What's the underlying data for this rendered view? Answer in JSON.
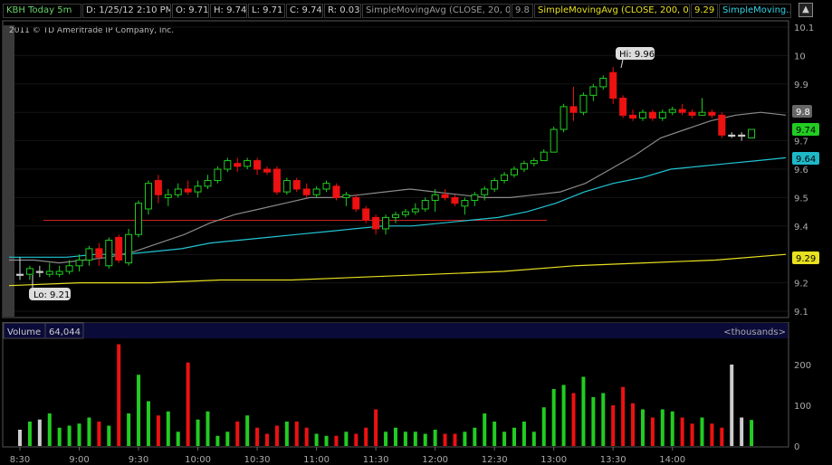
{
  "toolbar": {
    "symbol": "KBH Today 5m",
    "date": "D: 1/25/12 2:10 PM",
    "open": "O: 9.71",
    "high": "H: 9.74",
    "low": "L: 9.71",
    "close": "C: 9.74",
    "range": "R: 0.03",
    "sma20_label": "SimpleMovingAvg (CLOSE, 20, 0)",
    "sma20_value": "9.8",
    "sma200_label": "SimpleMovingAvg (CLOSE, 200, 0)",
    "sma200_value": "9.29",
    "sma_other_label": "SimpleMoving..."
  },
  "copyright": "2011 © TD Ameritrade IP Company, Inc.",
  "colors": {
    "up": "#22cc22",
    "down": "#ee1111",
    "flat": "#cccccc",
    "sma20": "#8a8a8a",
    "sma_cyan": "#22c4d4",
    "sma200": "#e8e020",
    "resistance": "#cc2222",
    "symbol_text": "#6ad36a",
    "date_text": "#cccccc",
    "sma20_text": "#9a9a9a",
    "sma200_text": "#e8e020",
    "sma_cyan_text": "#33d4e4"
  },
  "price_axis": {
    "ticks": [
      "10.1",
      "10",
      "9.9",
      "9.8",
      "9.7",
      "9.6",
      "9.5",
      "9.4",
      "9.3",
      "9.2",
      "9.1"
    ],
    "current_price": "9.74",
    "sma20_value": "9.8",
    "sma_cyan_value": "9.64",
    "sma200_value": "9.29"
  },
  "annotations": {
    "high": "Hi: 9.96",
    "low": "Lo: 9.21"
  },
  "volume": {
    "label": "Volume",
    "value": "64,044",
    "units": "<thousands>",
    "ticks": [
      "200",
      "100",
      "0"
    ]
  },
  "time_axis": [
    "8:30",
    "9:00",
    "9:30",
    "10:00",
    "10:30",
    "11:00",
    "11:30",
    "12:00",
    "12:30",
    "13:00",
    "13:30",
    "14:00"
  ],
  "chart_data": {
    "type": "candlestick",
    "interval": "5m",
    "ylim": [
      9.1,
      10.1
    ],
    "volume_ylim": [
      0,
      260
    ],
    "candles": [
      {
        "o": 9.23,
        "h": 9.29,
        "l": 9.21,
        "c": 9.23,
        "v": 40
      },
      {
        "o": 9.23,
        "h": 9.26,
        "l": 9.21,
        "c": 9.25,
        "v": 60
      },
      {
        "o": 9.24,
        "h": 9.26,
        "l": 9.22,
        "c": 9.24,
        "v": 65
      },
      {
        "o": 9.23,
        "h": 9.27,
        "l": 9.22,
        "c": 9.24,
        "v": 80
      },
      {
        "o": 9.23,
        "h": 9.26,
        "l": 9.22,
        "c": 9.24,
        "v": 45
      },
      {
        "o": 9.24,
        "h": 9.28,
        "l": 9.23,
        "c": 9.26,
        "v": 50
      },
      {
        "o": 9.26,
        "h": 9.3,
        "l": 9.24,
        "c": 9.28,
        "v": 55
      },
      {
        "o": 9.28,
        "h": 9.33,
        "l": 9.26,
        "c": 9.32,
        "v": 70
      },
      {
        "o": 9.32,
        "h": 9.34,
        "l": 9.26,
        "c": 9.29,
        "v": 60
      },
      {
        "o": 9.26,
        "h": 9.36,
        "l": 9.25,
        "c": 9.35,
        "v": 50
      },
      {
        "o": 9.36,
        "h": 9.37,
        "l": 9.27,
        "c": 9.28,
        "v": 250
      },
      {
        "o": 9.27,
        "h": 9.39,
        "l": 9.26,
        "c": 9.37,
        "v": 80
      },
      {
        "o": 9.37,
        "h": 9.49,
        "l": 9.36,
        "c": 9.48,
        "v": 175
      },
      {
        "o": 9.46,
        "h": 9.56,
        "l": 9.44,
        "c": 9.55,
        "v": 110
      },
      {
        "o": 9.56,
        "h": 9.58,
        "l": 9.48,
        "c": 9.51,
        "v": 75
      },
      {
        "o": 9.5,
        "h": 9.53,
        "l": 9.47,
        "c": 9.51,
        "v": 85
      },
      {
        "o": 9.51,
        "h": 9.55,
        "l": 9.5,
        "c": 9.53,
        "v": 35
      },
      {
        "o": 9.53,
        "h": 9.56,
        "l": 9.51,
        "c": 9.52,
        "v": 205
      },
      {
        "o": 9.52,
        "h": 9.56,
        "l": 9.5,
        "c": 9.54,
        "v": 65
      },
      {
        "o": 9.54,
        "h": 9.58,
        "l": 9.53,
        "c": 9.56,
        "v": 85
      },
      {
        "o": 9.56,
        "h": 9.61,
        "l": 9.55,
        "c": 9.6,
        "v": 25
      },
      {
        "o": 9.6,
        "h": 9.64,
        "l": 9.59,
        "c": 9.63,
        "v": 35
      },
      {
        "o": 9.62,
        "h": 9.64,
        "l": 9.59,
        "c": 9.61,
        "v": 60
      },
      {
        "o": 9.61,
        "h": 9.64,
        "l": 9.6,
        "c": 9.63,
        "v": 75
      },
      {
        "o": 9.63,
        "h": 9.64,
        "l": 9.58,
        "c": 9.6,
        "v": 45
      },
      {
        "o": 9.6,
        "h": 9.61,
        "l": 9.58,
        "c": 9.59,
        "v": 30
      },
      {
        "o": 9.6,
        "h": 9.61,
        "l": 9.51,
        "c": 9.52,
        "v": 50
      },
      {
        "o": 9.52,
        "h": 9.57,
        "l": 9.51,
        "c": 9.56,
        "v": 60
      },
      {
        "o": 9.56,
        "h": 9.57,
        "l": 9.52,
        "c": 9.53,
        "v": 60
      },
      {
        "o": 9.53,
        "h": 9.55,
        "l": 9.5,
        "c": 9.51,
        "v": 45
      },
      {
        "o": 9.51,
        "h": 9.54,
        "l": 9.5,
        "c": 9.53,
        "v": 30
      },
      {
        "o": 9.53,
        "h": 9.56,
        "l": 9.52,
        "c": 9.55,
        "v": 25
      },
      {
        "o": 9.54,
        "h": 9.55,
        "l": 9.49,
        "c": 9.5,
        "v": 25
      },
      {
        "o": 9.5,
        "h": 9.52,
        "l": 9.47,
        "c": 9.51,
        "v": 35
      },
      {
        "o": 9.5,
        "h": 9.51,
        "l": 9.45,
        "c": 9.46,
        "v": 30
      },
      {
        "o": 9.46,
        "h": 9.47,
        "l": 9.41,
        "c": 9.42,
        "v": 45
      },
      {
        "o": 9.43,
        "h": 9.44,
        "l": 9.37,
        "c": 9.39,
        "v": 90
      },
      {
        "o": 9.39,
        "h": 9.44,
        "l": 9.37,
        "c": 9.43,
        "v": 35
      },
      {
        "o": 9.43,
        "h": 9.45,
        "l": 9.41,
        "c": 9.44,
        "v": 45
      },
      {
        "o": 9.44,
        "h": 9.46,
        "l": 9.43,
        "c": 9.45,
        "v": 35
      },
      {
        "o": 9.45,
        "h": 9.48,
        "l": 9.44,
        "c": 9.46,
        "v": 35
      },
      {
        "o": 9.46,
        "h": 9.5,
        "l": 9.45,
        "c": 9.49,
        "v": 30
      },
      {
        "o": 9.49,
        "h": 9.53,
        "l": 9.45,
        "c": 9.51,
        "v": 40
      },
      {
        "o": 9.51,
        "h": 9.53,
        "l": 9.49,
        "c": 9.5,
        "v": 30
      },
      {
        "o": 9.5,
        "h": 9.51,
        "l": 9.47,
        "c": 9.48,
        "v": 30
      },
      {
        "o": 9.47,
        "h": 9.5,
        "l": 9.44,
        "c": 9.49,
        "v": 35
      },
      {
        "o": 9.49,
        "h": 9.52,
        "l": 9.47,
        "c": 9.51,
        "v": 45
      },
      {
        "o": 9.51,
        "h": 9.54,
        "l": 9.49,
        "c": 9.53,
        "v": 80
      },
      {
        "o": 9.53,
        "h": 9.57,
        "l": 9.52,
        "c": 9.56,
        "v": 60
      },
      {
        "o": 9.56,
        "h": 9.59,
        "l": 9.55,
        "c": 9.58,
        "v": 35
      },
      {
        "o": 9.58,
        "h": 9.61,
        "l": 9.57,
        "c": 9.6,
        "v": 45
      },
      {
        "o": 9.6,
        "h": 9.63,
        "l": 9.59,
        "c": 9.62,
        "v": 60
      },
      {
        "o": 9.62,
        "h": 9.64,
        "l": 9.61,
        "c": 9.63,
        "v": 35
      },
      {
        "o": 9.63,
        "h": 9.67,
        "l": 9.63,
        "c": 9.66,
        "v": 95
      },
      {
        "o": 9.66,
        "h": 9.75,
        "l": 9.66,
        "c": 9.74,
        "v": 140
      },
      {
        "o": 9.74,
        "h": 9.83,
        "l": 9.73,
        "c": 9.82,
        "v": 150
      },
      {
        "o": 9.82,
        "h": 9.89,
        "l": 9.77,
        "c": 9.8,
        "v": 130
      },
      {
        "o": 9.8,
        "h": 9.87,
        "l": 9.79,
        "c": 9.86,
        "v": 170
      },
      {
        "o": 9.86,
        "h": 9.9,
        "l": 9.84,
        "c": 9.89,
        "v": 120
      },
      {
        "o": 9.89,
        "h": 9.93,
        "l": 9.88,
        "c": 9.92,
        "v": 130
      },
      {
        "o": 9.94,
        "h": 9.96,
        "l": 9.83,
        "c": 9.85,
        "v": 100
      },
      {
        "o": 9.85,
        "h": 9.86,
        "l": 9.78,
        "c": 9.79,
        "v": 145
      },
      {
        "o": 9.79,
        "h": 9.81,
        "l": 9.77,
        "c": 9.78,
        "v": 105
      },
      {
        "o": 9.78,
        "h": 9.81,
        "l": 9.77,
        "c": 9.8,
        "v": 90
      },
      {
        "o": 9.8,
        "h": 9.81,
        "l": 9.77,
        "c": 9.78,
        "v": 70
      },
      {
        "o": 9.78,
        "h": 9.81,
        "l": 9.77,
        "c": 9.8,
        "v": 90
      },
      {
        "o": 9.8,
        "h": 9.82,
        "l": 9.79,
        "c": 9.81,
        "v": 85
      },
      {
        "o": 9.81,
        "h": 9.83,
        "l": 9.79,
        "c": 9.8,
        "v": 70
      },
      {
        "o": 9.8,
        "h": 9.81,
        "l": 9.78,
        "c": 9.79,
        "v": 55
      },
      {
        "o": 9.79,
        "h": 9.85,
        "l": 9.79,
        "c": 9.8,
        "v": 70
      },
      {
        "o": 9.8,
        "h": 9.81,
        "l": 9.78,
        "c": 9.79,
        "v": 55
      },
      {
        "o": 9.79,
        "h": 9.8,
        "l": 9.71,
        "c": 9.72,
        "v": 45
      },
      {
        "o": 9.72,
        "h": 9.73,
        "l": 9.71,
        "c": 9.72,
        "v": 200
      },
      {
        "o": 9.72,
        "h": 9.73,
        "l": 9.7,
        "c": 9.72,
        "v": 70
      },
      {
        "o": 9.71,
        "h": 9.74,
        "l": 9.71,
        "c": 9.74,
        "v": 64
      }
    ],
    "resistance_level": 9.42,
    "sma20": [
      9.28,
      9.28,
      9.27,
      9.28,
      9.29,
      9.31,
      9.34,
      9.37,
      9.41,
      9.44,
      9.46,
      9.48,
      9.5,
      9.5,
      9.51,
      9.52,
      9.53,
      9.52,
      9.51,
      9.5,
      9.5,
      9.51,
      9.52,
      9.55,
      9.6,
      9.65,
      9.71,
      9.74,
      9.77,
      9.79,
      9.8,
      9.79
    ],
    "sma_cyan": [
      9.29,
      9.29,
      9.29,
      9.3,
      9.3,
      9.31,
      9.32,
      9.34,
      9.35,
      9.36,
      9.37,
      9.38,
      9.39,
      9.4,
      9.4,
      9.41,
      9.42,
      9.43,
      9.45,
      9.48,
      9.52,
      9.55,
      9.57,
      9.6,
      9.61,
      9.62,
      9.63,
      9.64
    ],
    "sma200": [
      9.19,
      9.2,
      9.2,
      9.21,
      9.21,
      9.22,
      9.23,
      9.24,
      9.26,
      9.27,
      9.28,
      9.3
    ]
  }
}
